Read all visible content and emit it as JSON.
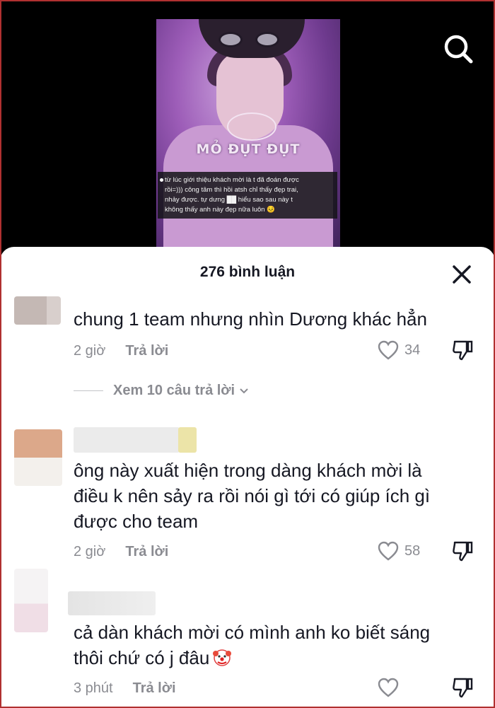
{
  "video": {
    "watermark": "MỎ ĐỤT ĐỤT",
    "caption_lines": [
      "từ lúc giới thiệu khách mời là t đã đoán được",
      "rồi=))) công tâm thì hồi atsh chỉ thấy đẹp trai,",
      "nhảy được. tự dưng ██ hiểu sao sau này t",
      "không thấy anh này đẹp nữa luôn 😣"
    ]
  },
  "header": {
    "icons": [
      "search-icon"
    ]
  },
  "comments_sheet": {
    "title": "276 bình luận",
    "close_icon": "close-icon",
    "reply_label": "Trả lời",
    "comments": [
      {
        "text": "chung 1 team nhưng nhìn Dương khác hẳn",
        "time": "2 giờ",
        "likes": "34"
      },
      {
        "text_lines": [
          "ông này xuất hiện trong dàng khách mời là",
          "điều k nên sảy ra rồi nói gì tới có giúp ích gì",
          "được cho team"
        ],
        "time": "2 giờ",
        "likes": "58"
      },
      {
        "text_lines": [
          "cả dàn khách mời có mình anh ko biết sáng",
          "thôi chứ có j đâu"
        ],
        "emoji": "clown-face-icon",
        "time": "3 phút",
        "likes": ""
      }
    ],
    "view_replies": "Xem 10 câu trả lời"
  }
}
